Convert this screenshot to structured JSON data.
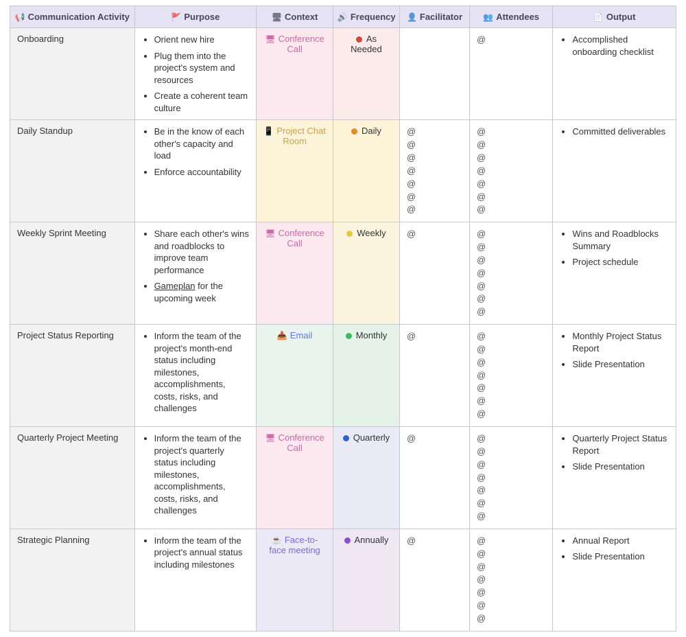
{
  "headers": {
    "activity": {
      "icon": "📢",
      "label": "Communication Activity"
    },
    "purpose": {
      "icon": "🚩",
      "label": "Purpose"
    },
    "context": {
      "icon": "🖥",
      "label": "Context"
    },
    "frequency": {
      "icon": "🔊",
      "label": "Frequency"
    },
    "facilitator": {
      "icon": "👤",
      "label": "Facilitator"
    },
    "attendees": {
      "icon": "👥",
      "label": "Attendees"
    },
    "output": {
      "icon": "📄",
      "label": "Output"
    }
  },
  "context_types": {
    "confcall": {
      "icon": "🖥",
      "label": "Conference Call"
    },
    "chat": {
      "icon": "📱",
      "label": "Project Chat Room"
    },
    "email": {
      "icon": "📥",
      "label": "Email"
    },
    "f2f": {
      "icon": "☕",
      "label": "Face-to-face meeting"
    }
  },
  "frequency_types": {
    "asneeded": {
      "color": "#d9443a",
      "label": "As Needed"
    },
    "daily": {
      "color": "#e48a25",
      "label": "Daily"
    },
    "weekly": {
      "color": "#e6c83c",
      "label": "Weekly"
    },
    "monthly": {
      "color": "#3fba5f",
      "label": "Monthly"
    },
    "quarterly": {
      "color": "#2f5fd0",
      "label": "Quarterly"
    },
    "annually": {
      "color": "#8a4fcf",
      "label": "Annually"
    }
  },
  "rows": [
    {
      "name": "Onboarding",
      "purpose": [
        "Orient new hire",
        "Plug them into the project's system and resources",
        "Create a coherent team culture"
      ],
      "context": "confcall",
      "frequency": "asneeded",
      "facilitator_count": 0,
      "attendees_count": 1,
      "output": [
        "Accomplished onboarding checklist"
      ]
    },
    {
      "name": "Daily Standup",
      "purpose": [
        "Be in the know of each other's capacity and load",
        "Enforce accountability"
      ],
      "context": "chat",
      "frequency": "daily",
      "facilitator_count": 7,
      "attendees_count": 7,
      "output": [
        "Committed deliverables"
      ]
    },
    {
      "name": "Weekly Sprint Meeting",
      "purpose": [
        "Share each other's wins and roadblocks to improve team performance",
        "_Gameplan_ for the upcoming week"
      ],
      "context": "confcall",
      "frequency": "weekly",
      "facilitator_count": 1,
      "attendees_count": 7,
      "output": [
        "Wins and Roadblocks Summary",
        "Project schedule"
      ]
    },
    {
      "name": "Project Status Reporting",
      "purpose": [
        "Inform the team of the project's month-end status including milestones, accomplishments, costs, risks, and challenges"
      ],
      "context": "email",
      "frequency": "monthly",
      "facilitator_count": 1,
      "attendees_count": 7,
      "output": [
        "Monthly Project Status Report",
        "Slide Presentation"
      ]
    },
    {
      "name": "Quarterly Project Meeting",
      "purpose": [
        "Inform the team of the project's quarterly status including milestones, accomplishments, costs, risks, and challenges"
      ],
      "context": "confcall",
      "frequency": "quarterly",
      "facilitator_count": 1,
      "attendees_count": 7,
      "output": [
        "Quarterly Project Status Report",
        "Slide Presentation"
      ]
    },
    {
      "name": "Strategic Planning",
      "purpose": [
        "Inform the team of the project's annual status including milestones"
      ],
      "context": "f2f",
      "frequency": "annually",
      "facilitator_count": 1,
      "attendees_count": 7,
      "output": [
        "Annual Report",
        "Slide Presentation"
      ]
    }
  ]
}
